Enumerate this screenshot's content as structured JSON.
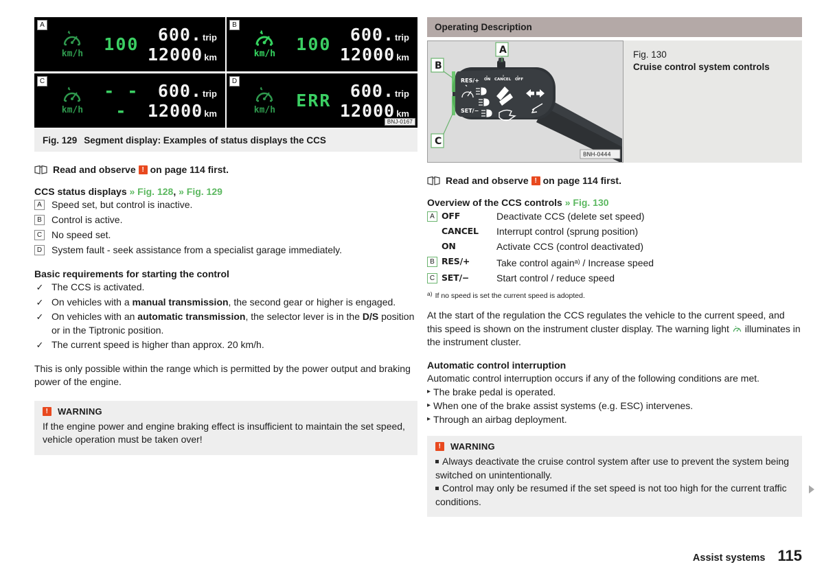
{
  "left": {
    "fig129": {
      "panels": [
        {
          "tag": "A",
          "speed": "100",
          "unit": "km/h",
          "trip_value": "600.",
          "trip_label": "trip",
          "odo_value": "12000",
          "odo_unit": "km",
          "state": "inactive"
        },
        {
          "tag": "B",
          "speed": "100",
          "unit": "km/h",
          "trip_value": "600.",
          "trip_label": "trip",
          "odo_value": "12000",
          "odo_unit": "km",
          "state": "active"
        },
        {
          "tag": "C",
          "speed": "- - -",
          "unit": "km/h",
          "trip_value": "600.",
          "trip_label": "trip",
          "odo_value": "12000",
          "odo_unit": "km",
          "state": "inactive"
        },
        {
          "tag": "D",
          "speed": "ERR",
          "unit": "km/h",
          "trip_value": "600.",
          "trip_label": "trip",
          "odo_value": "12000",
          "odo_unit": "km",
          "state": "inactive"
        }
      ],
      "image_code": "BNJ-0167",
      "caption_number": "Fig. 129",
      "caption_text": "Segment display: Examples of status displays the CCS"
    },
    "read_observe": {
      "pre": "Read and observe",
      "post": "on page 114 first."
    },
    "status_heading": {
      "title": "CCS status displays",
      "xref1": "» Fig. 128",
      "sep": ",",
      "xref2": "» Fig. 129"
    },
    "status_items": [
      {
        "key": "A",
        "text": "Speed set, but control is inactive."
      },
      {
        "key": "B",
        "text": "Control is active."
      },
      {
        "key": "C",
        "text": "No speed set."
      },
      {
        "key": "D",
        "text": "System fault - seek assistance from a specialist garage immediately."
      }
    ],
    "requirements_heading": "Basic requirements for starting the control",
    "requirements": [
      {
        "mark": "✓",
        "html": "The CCS is activated."
      },
      {
        "mark": "✓",
        "html": "On vehicles with a <b>manual transmission</b>, the second gear or higher is engaged."
      },
      {
        "mark": "✓",
        "html": "On vehicles with an <b>automatic transmission</b>, the selector lever is in the <b>D/S</b> position or in the Tiptronic position."
      },
      {
        "mark": "✓",
        "html": "The current speed is higher than approx. 20 km/h."
      }
    ],
    "paragraph": "This is only possible within the range which is permitted by the power output and braking power of the engine.",
    "warning": {
      "title": "WARNING",
      "icon": "!",
      "body": "If the engine power and engine braking effect is insufficient to maintain the set speed, vehicle operation must be taken over!"
    }
  },
  "right": {
    "section_title": "Operating Description",
    "fig130": {
      "caption_number": "Fig. 130",
      "caption_text": "Cruise control system controls",
      "image_code": "BNH-0444",
      "markers": [
        "A",
        "B",
        "C"
      ],
      "stalk_labels": {
        "res": "RES/+",
        "set": "SET/−",
        "on": "ON",
        "cancel": "CANCEL",
        "off": "OFF"
      }
    },
    "read_observe": {
      "pre": "Read and observe",
      "post": "on page 114 first."
    },
    "overview_heading": {
      "title": "Overview of the CCS controls",
      "xref": "» Fig. 130"
    },
    "overview_rows": [
      {
        "key": "A",
        "label": "OFF",
        "desc": "Deactivate CCS (delete set speed)",
        "footnote": ""
      },
      {
        "key": "",
        "label": "CANCEL",
        "desc": "Interrupt control (sprung position)",
        "footnote": ""
      },
      {
        "key": "",
        "label": "ON",
        "desc": "Activate CCS (control deactivated)",
        "footnote": ""
      },
      {
        "key": "B",
        "label": "RES/+",
        "desc": "Take control again",
        "footnote": "a)",
        "desc_tail": " / Increase speed"
      },
      {
        "key": "C",
        "label": "SET/−",
        "desc": "Start control / reduce speed",
        "footnote": ""
      }
    ],
    "footnote": {
      "marker": "a)",
      "text": "If no speed is set the current speed is adopted."
    },
    "paragraph_pre": "At the start of the regulation the CCS regulates the vehicle to the current speed, and this speed is shown on the instrument cluster display. The warning light",
    "paragraph_post": "illuminates in the instrument cluster.",
    "auto_heading": "Automatic control interruption",
    "auto_intro": "Automatic control interruption occurs if any of the following conditions are met.",
    "auto_items": [
      "The brake pedal is operated.",
      "When one of the brake assist systems (e.g. ESC) intervenes.",
      "Through an airbag deployment."
    ],
    "warning": {
      "title": "WARNING",
      "icon": "!",
      "items": [
        "Always deactivate the cruise control system after use to prevent the system being switched on unintentionally.",
        "Control may only be resumed if the set speed is not too high for the current traffic conditions."
      ]
    }
  },
  "footer": {
    "chapter": "Assist systems",
    "page": "115"
  },
  "colors": {
    "section_bar": "#b4a9a7",
    "caption_bg": "#eeeeee",
    "warning_orange": "#e8491f",
    "xref_green": "#5cb860",
    "display_green": "#3bcf63",
    "display_green_dim": "#2f9a4e"
  }
}
